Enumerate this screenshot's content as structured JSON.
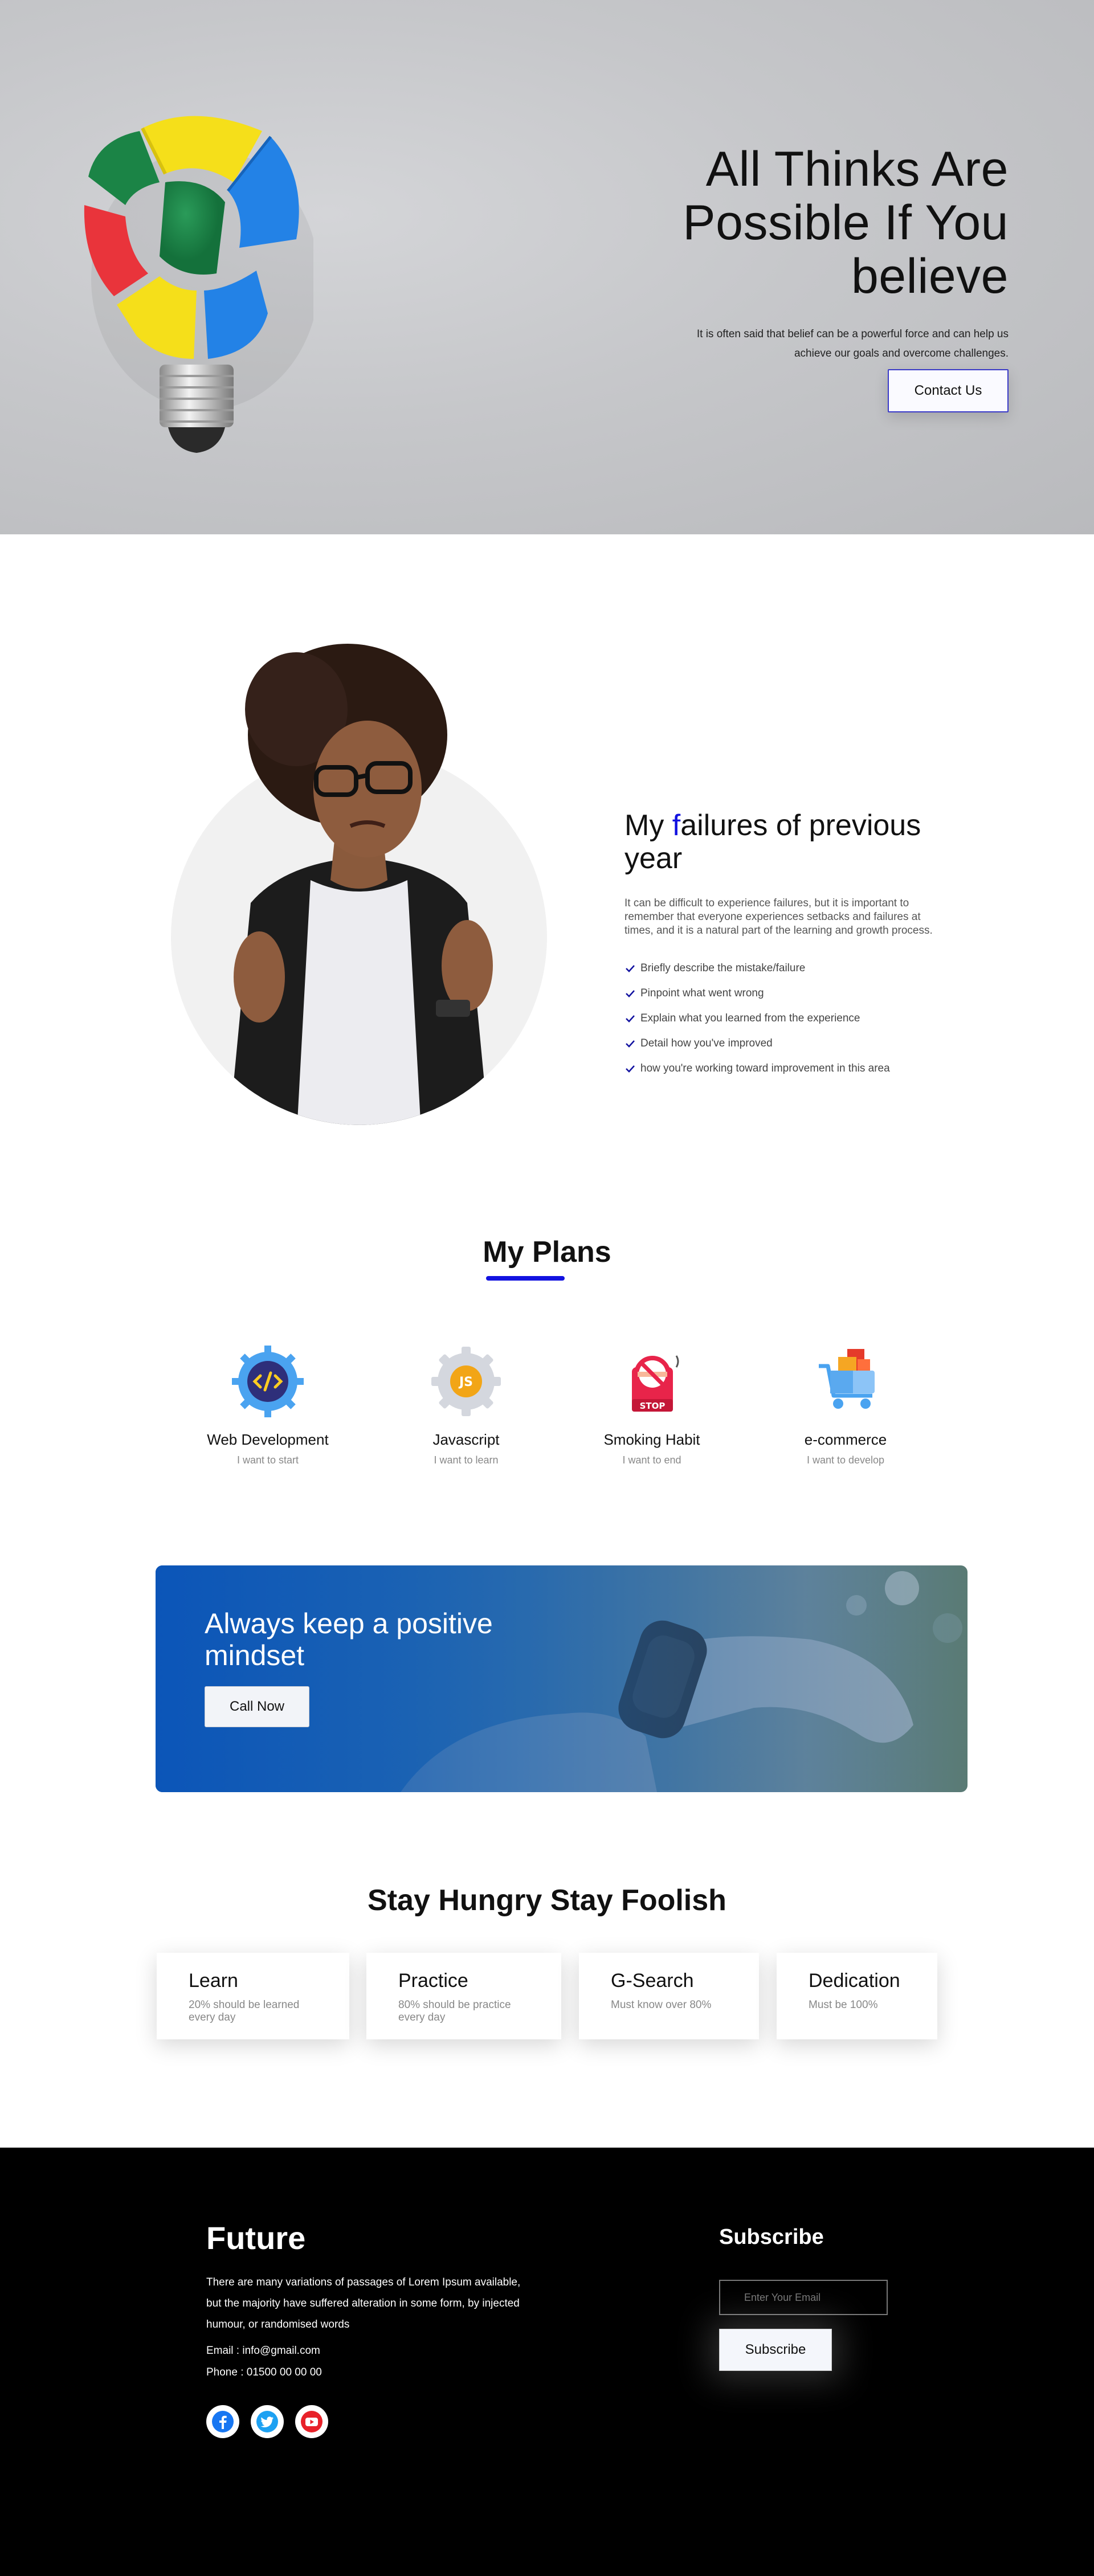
{
  "hero": {
    "title": "All Thinks Are Possible If You believe",
    "subtitle": "It is often said that belief can be a powerful force and can help us achieve our goals and overcome challenges.",
    "cta_label": "Contact Us"
  },
  "failures": {
    "title_first_letter": "f",
    "title_prefix": "My ",
    "title_suffix": "ailures of previous year",
    "description": "It can be difficult to experience failures, but it is important to remember that everyone experiences setbacks and failures at times, and it is a natural part of the learning and growth process.",
    "items": [
      "Briefly describe the mistake/failure",
      "Pinpoint what went wrong",
      "Explain what you learned from the experience",
      "Detail how you've improved",
      "how you're working toward improvement in this area"
    ]
  },
  "plans": {
    "title": "My Plans",
    "items": [
      {
        "name": "Web Development",
        "note": "I want to start",
        "icon": "code-gear-icon"
      },
      {
        "name": "Javascript",
        "note": "I want to learn",
        "icon": "js-gear-icon"
      },
      {
        "name": "Smoking Habit",
        "note": "I want to end",
        "icon": "no-smoking-icon"
      },
      {
        "name": "e-commerce",
        "note": "I want to develop",
        "icon": "shopping-cart-icon"
      }
    ]
  },
  "banner": {
    "title": "Always keep a positive mindset",
    "cta_label": "Call Now"
  },
  "stay": {
    "title": "Stay Hungry Stay Foolish",
    "cards": [
      {
        "title": "Learn",
        "text": "20% should be learned every day"
      },
      {
        "title": "Practice",
        "text": "80% should be practice every day"
      },
      {
        "title": "G-Search",
        "text": "Must know over 80%"
      },
      {
        "title": "Dedication",
        "text": "Must be 100%"
      }
    ]
  },
  "footer": {
    "brand": "Future",
    "description": "There are many variations of passages of Lorem Ipsum available, but the majority have suffered alteration in some form, by injected humour, or randomised words",
    "email": "Email : info@gmail.com",
    "phone": "Phone : 01500 00 00 00",
    "socials": [
      "facebook-icon",
      "twitter-icon",
      "youtube-icon"
    ],
    "subscribe_title": "Subscribe",
    "subscribe_placeholder": "Enter Your Email",
    "subscribe_label": "Subscribe"
  },
  "colors": {
    "accent": "#1212e0",
    "footer_bg": "#000000",
    "hero_bg": "#c6c7ca"
  }
}
